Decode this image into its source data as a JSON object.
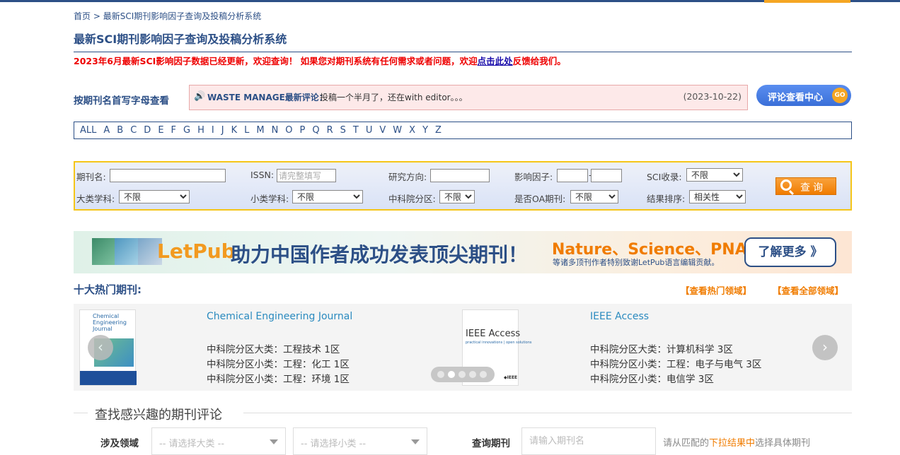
{
  "breadcrumb": {
    "home": "首页",
    "sep": " > ",
    "current": "最新SCI期刊影响因子查询及投稿分析系统"
  },
  "page_title": "最新SCI期刊影响因子查询及投稿分析系统",
  "notice": {
    "text1": "2023年6月最新SCI影响因子数据已经更新，欢迎查询！ 如果您对期刊系统有任何需求或者问题，欢迎",
    "link": "点击此处",
    "text2": "反馈给我们。"
  },
  "letter_label": "按期刊名首写字母查看",
  "news": {
    "icon": "speaker-icon",
    "source": "WASTE MANAGE最新评论：",
    "text": "投稿一个半月了，还在with editor。。。",
    "date": "(2023-10-22)"
  },
  "review_center": {
    "label": "评论查看中心",
    "go": "GO"
  },
  "alphabet": [
    "ALL",
    "A",
    "B",
    "C",
    "D",
    "E",
    "F",
    "G",
    "H",
    "I",
    "J",
    "K",
    "L",
    "M",
    "N",
    "O",
    "P",
    "Q",
    "R",
    "S",
    "T",
    "U",
    "V",
    "W",
    "X",
    "Y",
    "Z"
  ],
  "search": {
    "journal_label": "期刊名:",
    "issn_label": "ISSN:",
    "issn_placeholder": "请完整填写",
    "field_label": "研究方向:",
    "if_label": "影响因子:",
    "if_sep": "-",
    "sci_label": "SCI收录:",
    "sci_value": "不限",
    "major_label": "大类学科:",
    "major_value": "不限",
    "minor_label": "小类学科:",
    "minor_value": "不限",
    "cas_label": "中科院分区:",
    "cas_value": "不限",
    "oa_label": "是否OA期刊:",
    "oa_value": "不限",
    "sort_label": "结果排序:",
    "sort_value": "相关性",
    "button": "查询"
  },
  "banner": {
    "brand": "LetPub",
    "slogan": "助力中国作者成功发表顶尖期刊！",
    "journals": "Nature、Science、PNAS",
    "sub": "等诸多顶刊作者特别致谢LetPub语言编辑贡献。",
    "more": "了解更多 》"
  },
  "hot": {
    "title": "十大热门期刊:",
    "link_fields": "【查看热门领域】",
    "link_all": "【查看全部领域】",
    "journals": [
      {
        "name": "Chemical Engineering Journal",
        "cover_text": "Chemical Engineering Journal",
        "lines": [
          "中科院分区大类：工程技术 1区",
          "中科院分区小类：工程：化工 1区",
          "中科院分区小类：工程：环境 1区"
        ]
      },
      {
        "name": "IEEE Access",
        "cover_text": "IEEE Access",
        "cover_tag": "practical innovations | open solutions",
        "cover_mark": "◆IEEE",
        "lines": [
          "中科院分区大类：计算机科学 3区",
          "中科院分区小类：工程：电子与电气 3区",
          "中科院分区小类：电信学 3区"
        ]
      }
    ],
    "prev": "‹",
    "next": "›"
  },
  "review_search": {
    "title": "查找感兴趣的期刊评论",
    "field_label": "涉及领域",
    "major_placeholder": "-- 请选择大类 --",
    "minor_placeholder": "-- 请选择小类 --",
    "journal_label": "查询期刊",
    "journal_placeholder": "请输入期刊名",
    "hint_a": "请从匹配的",
    "hint_b": "下拉结果中",
    "hint_c": "选择具体期刊"
  }
}
